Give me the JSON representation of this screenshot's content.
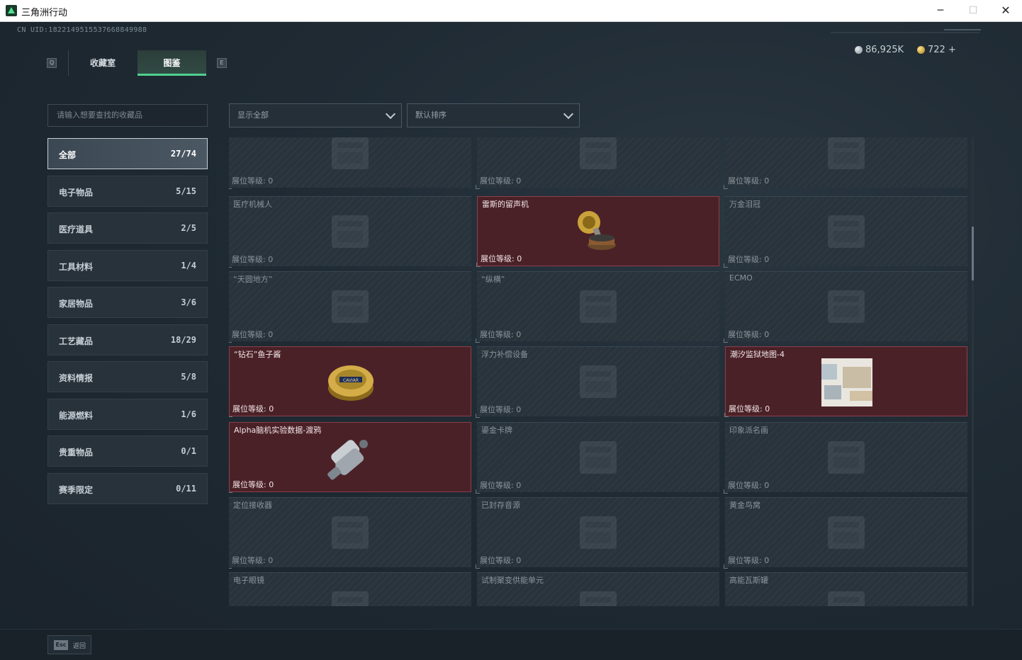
{
  "window": {
    "title": "三角洲行动",
    "minimize": "─",
    "maximize": "☐",
    "close": "✕"
  },
  "header": {
    "uid": "CN UID:1822149515537668849988",
    "silver_amount": "86,925K",
    "gold_amount": "722 +"
  },
  "tabs": {
    "left_key": "Q",
    "right_key": "E",
    "items": [
      "收藏室",
      "图鉴"
    ],
    "active": "图鉴"
  },
  "search": {
    "placeholder": "请输入想要查找的收藏品"
  },
  "categories": [
    {
      "label": "全部",
      "count": "27/74",
      "active": true
    },
    {
      "label": "电子物品",
      "count": "5/15"
    },
    {
      "label": "医疗道具",
      "count": "2/5"
    },
    {
      "label": "工具材料",
      "count": "1/4"
    },
    {
      "label": "家居物品",
      "count": "3/6"
    },
    {
      "label": "工艺藏品",
      "count": "18/29"
    },
    {
      "label": "资料情报",
      "count": "5/8"
    },
    {
      "label": "能源燃料",
      "count": "1/6"
    },
    {
      "label": "贵重物品",
      "count": "0/1"
    },
    {
      "label": "赛季限定",
      "count": "0/11"
    }
  ],
  "filters": {
    "display": "显示全部",
    "sort": "默认排序"
  },
  "level_label": "展位等级: 0",
  "items": [
    {
      "name": "",
      "owned": false,
      "icon": "lamp-icon"
    },
    {
      "name": "",
      "owned": false,
      "icon": "machine-icon"
    },
    {
      "name": "",
      "owned": false,
      "icon": "crate-icon"
    },
    {
      "name": "医疗机械人",
      "owned": false,
      "icon": "robot-arm-icon"
    },
    {
      "name": "雷斯的留声机",
      "owned": true,
      "icon": "gramophone-icon"
    },
    {
      "name": "万金泪冠",
      "owned": false,
      "icon": "crown-icon"
    },
    {
      "name": "“天圆地方”",
      "owned": false,
      "icon": "armillary-icon"
    },
    {
      "name": "“纵横”",
      "owned": false,
      "icon": "chessboard-icon"
    },
    {
      "name": "ECMO",
      "owned": false,
      "icon": "ecmo-icon"
    },
    {
      "name": "“钻石”鱼子酱",
      "owned": true,
      "icon": "caviar-tin-icon"
    },
    {
      "name": "浮力补偿设备",
      "owned": false,
      "icon": "vest-icon"
    },
    {
      "name": "潮汐监狱地图-4",
      "owned": true,
      "icon": "map-icon"
    },
    {
      "name": "Alpha脑机实验数据-渡鸦",
      "owned": true,
      "icon": "data-cylinder-icon"
    },
    {
      "name": "鎏金卡牌",
      "owned": false,
      "icon": "card-icon"
    },
    {
      "name": "印象派名画",
      "owned": false,
      "icon": "painting-icon"
    },
    {
      "name": "定位接收器",
      "owned": false,
      "icon": "receiver-icon"
    },
    {
      "name": "已封存音源",
      "owned": false,
      "icon": "audio-device-icon"
    },
    {
      "name": "黄金鸟窝",
      "owned": false,
      "icon": "nest-icon"
    },
    {
      "name": "电子眼镜",
      "owned": false,
      "icon": "glasses-icon"
    },
    {
      "name": "试制聚变供能单元",
      "owned": false,
      "icon": "fusion-unit-icon"
    },
    {
      "name": "高能瓦斯罐",
      "owned": false,
      "icon": "gas-can-icon"
    }
  ],
  "footer": {
    "esc_key": "Esc",
    "esc_label": "返回"
  }
}
